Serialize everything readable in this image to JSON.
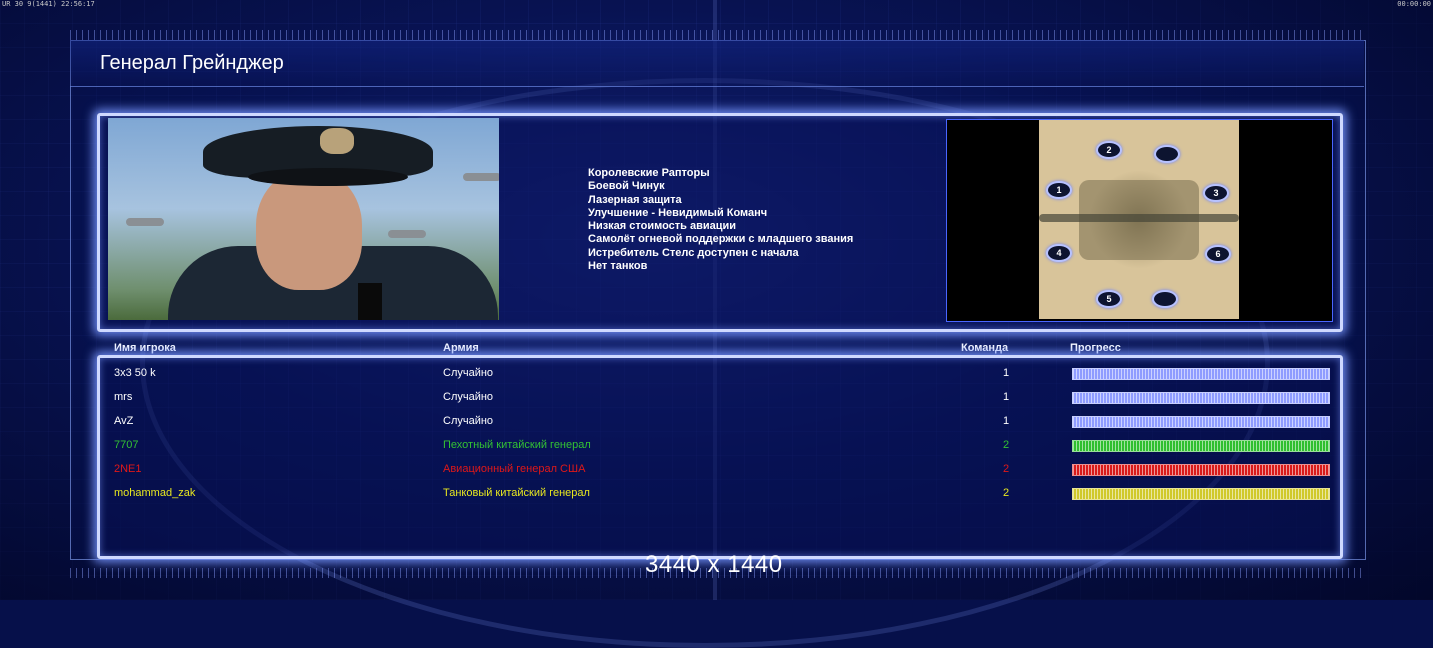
{
  "hud": {
    "left_text": "UR 30 9(1441) 22:56:17",
    "right_text": "00:00:00"
  },
  "general": {
    "title": "Генерал Грейнджер"
  },
  "traits": [
    "Королевские Рапторы",
    "Боевой Чинук",
    "Лазерная защита",
    "Улучшение - Невидимый Команч",
    "Низкая стоимость авиации",
    "Самолёт огневой поддержки с младшего звания",
    "Истребитель Стелс доступен с начала",
    "Нет танков"
  ],
  "map": {
    "spots": [
      "1",
      "2",
      "3",
      "4",
      "5",
      "6",
      "",
      ""
    ]
  },
  "table": {
    "headers": {
      "name": "Имя игрока",
      "army": "Армия",
      "team": "Команда",
      "progress": "Прогресс"
    },
    "players": [
      {
        "name": "3x3 50 k",
        "army": "Случайно",
        "team": "1",
        "color": "#ffffff",
        "bar_color": "#8f9cff",
        "progress": 1.0
      },
      {
        "name": "mrs",
        "army": "Случайно",
        "team": "1",
        "color": "#ffffff",
        "bar_color": "#8f9cff",
        "progress": 1.0
      },
      {
        "name": "AvZ",
        "army": "Случайно",
        "team": "1",
        "color": "#ffffff",
        "bar_color": "#8f9cff",
        "progress": 1.0
      },
      {
        "name": "7707",
        "army": "Пехотный китайский генерал",
        "team": "2",
        "color": "#33c233",
        "bar_color": "#2fbf2f",
        "progress": 1.0
      },
      {
        "name": "2NE1",
        "army": "Авиационный генерал США",
        "team": "2",
        "color": "#e01818",
        "bar_color": "#d81a1a",
        "progress": 1.0
      },
      {
        "name": "mohammad_zak",
        "army": "Танковый китайский генерал",
        "team": "2",
        "color": "#e8e820",
        "bar_color": "#d0c92a",
        "progress": 1.0
      }
    ]
  },
  "resolution_label": "3440 x 1440"
}
